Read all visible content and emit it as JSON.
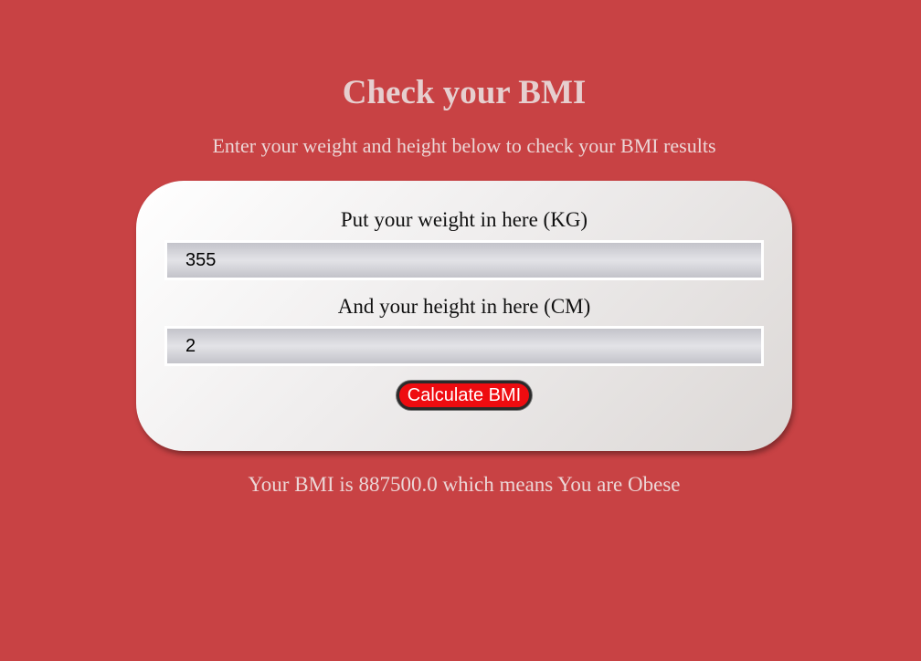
{
  "header": {
    "title": "Check your BMI",
    "subtitle": "Enter your weight and height below to check your BMI results"
  },
  "form": {
    "weight_label": "Put your weight in here (KG)",
    "weight_value": "355",
    "height_label": "And your height in here (CM)",
    "height_value": "2",
    "calculate_label": "Calculate BMI"
  },
  "result": {
    "text": "Your BMI is 887500.0 which means You are Obese"
  },
  "colors": {
    "background": "#c84244",
    "button": "#ee0c10",
    "card": "#efeded"
  }
}
